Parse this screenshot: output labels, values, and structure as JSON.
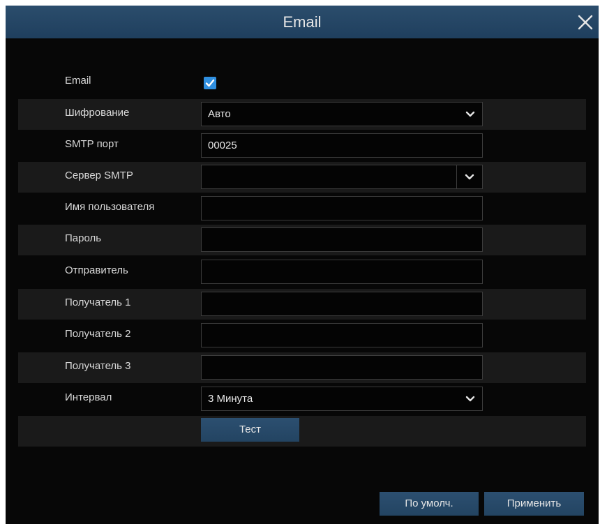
{
  "window": {
    "title": "Email",
    "close_icon": "close-icon"
  },
  "form": {
    "email": {
      "label": "Email",
      "checked": true
    },
    "encryption": {
      "label": "Шифрование",
      "value": "Авто"
    },
    "smtp_port": {
      "label": "SMTP порт",
      "value": "00025"
    },
    "smtp_server": {
      "label": "Сервер SMTP",
      "value": ""
    },
    "username": {
      "label": "Имя пользователя",
      "value": ""
    },
    "password": {
      "label": "Пароль",
      "value": ""
    },
    "sender": {
      "label": "Отправитель",
      "value": ""
    },
    "recipient1": {
      "label": "Получатель 1",
      "value": ""
    },
    "recipient2": {
      "label": "Получатель 2",
      "value": ""
    },
    "recipient3": {
      "label": "Получатель 3",
      "value": ""
    },
    "interval": {
      "label": "Интервал",
      "value": "3 Минута"
    },
    "test_label": "Тест"
  },
  "footer": {
    "default_label": "По умолч.",
    "apply_label": "Применить"
  },
  "colors": {
    "titlebar": "#24466a",
    "background": "#070707",
    "row_stripe": "#1a1a1a",
    "accent": "#2f8fe0",
    "button": "#27486a"
  }
}
